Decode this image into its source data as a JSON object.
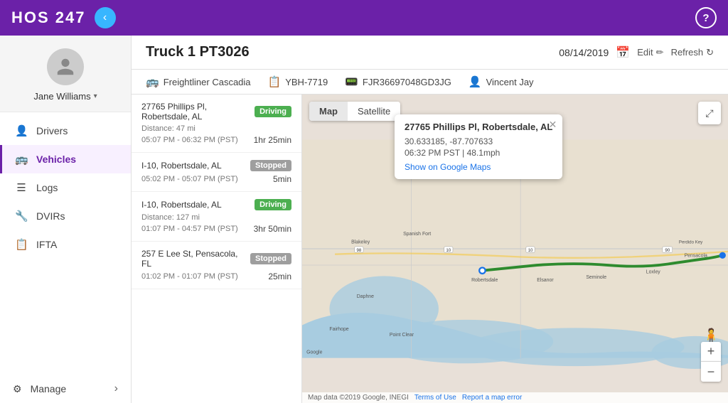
{
  "header": {
    "logo": "HOS 247",
    "back_icon": "‹",
    "help_icon": "?"
  },
  "sidebar": {
    "user": {
      "name": "Jane Williams",
      "chevron": "▾"
    },
    "nav_items": [
      {
        "id": "drivers",
        "label": "Drivers",
        "icon": "👤",
        "active": false
      },
      {
        "id": "vehicles",
        "label": "Vehicles",
        "icon": "🚌",
        "active": true
      },
      {
        "id": "logs",
        "label": "Logs",
        "icon": "☰",
        "active": false
      },
      {
        "id": "dvirs",
        "label": "DVIRs",
        "icon": "🔧",
        "active": false
      },
      {
        "id": "ifta",
        "label": "IFTA",
        "icon": "📋",
        "active": false
      }
    ],
    "manage": {
      "label": "Manage",
      "icon": "⚙",
      "chevron": "›"
    }
  },
  "content_header": {
    "title": "Truck 1 PT3026",
    "date": "08/14/2019",
    "edit_label": "Edit",
    "refresh_label": "Refresh"
  },
  "info_bar": {
    "truck": "Freightliner Cascadia",
    "plate": "YBH-7719",
    "vin": "FJR36697048GD3JG",
    "driver": "Vincent Jay"
  },
  "trips": [
    {
      "address": "27765 Phillips Pl, Robertsdale, AL",
      "badge": "Driving",
      "badge_type": "driving",
      "distance": "Distance: 47 mi",
      "time_range": "05:07 PM - 06:32 PM (PST)",
      "duration": "1hr 25min"
    },
    {
      "address": "I-10, Robertsdale, AL",
      "badge": "Stopped",
      "badge_type": "stopped",
      "distance": "",
      "time_range": "05:02 PM - 05:07 PM (PST)",
      "duration": "5min"
    },
    {
      "address": "I-10, Robertsdale, AL",
      "badge": "Driving",
      "badge_type": "driving",
      "distance": "Distance: 127 mi",
      "time_range": "01:07 PM - 04:57 PM (PST)",
      "duration": "3hr 50min"
    },
    {
      "address": "257 E Lee St, Pensacola, FL",
      "badge": "Stopped",
      "badge_type": "stopped",
      "distance": "",
      "time_range": "01:02 PM - 01:07 PM (PST)",
      "duration": "25min"
    }
  ],
  "map": {
    "tab_map": "Map",
    "tab_satellite": "Satellite",
    "popup": {
      "title": "27765 Phillips Pl, Robertsdale, AL",
      "coords": "30.633185, -87.707633",
      "info": "06:32 PM PST | 48.1mph",
      "link": "Show on Google Maps"
    },
    "zoom_plus": "+",
    "zoom_minus": "−",
    "footer_credit": "Map data ©2019 Google, INEGI",
    "terms": "Terms of Use",
    "report": "Report a map error"
  }
}
